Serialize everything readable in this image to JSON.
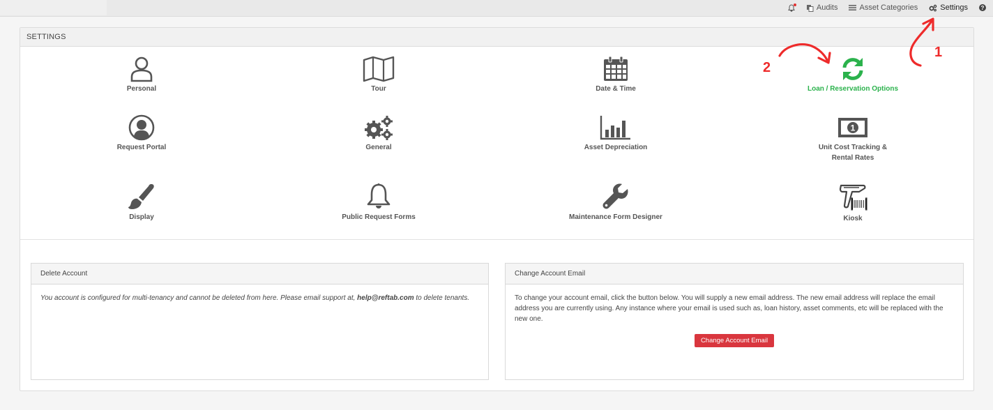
{
  "topnav": {
    "audits": "Audits",
    "asset_categories": "Asset Categories",
    "settings": "Settings"
  },
  "settings_panel": {
    "title": "SETTINGS",
    "tiles": [
      {
        "label": "Personal",
        "icon": "user-icon"
      },
      {
        "label": "Tour",
        "icon": "map-icon"
      },
      {
        "label": "Date & Time",
        "icon": "calendar-icon"
      },
      {
        "label": "Loan / Reservation Options",
        "icon": "refresh-icon"
      },
      {
        "label": "Request Portal",
        "icon": "user-circle-icon"
      },
      {
        "label": "General",
        "icon": "gears-icon"
      },
      {
        "label": "Asset Depreciation",
        "icon": "bar-chart-icon"
      },
      {
        "label": "Unit Cost Tracking &",
        "label2": "Rental Rates",
        "icon": "money-icon"
      },
      {
        "label": "Display",
        "icon": "paintbrush-icon"
      },
      {
        "label": "Public Request Forms",
        "icon": "bell-icon"
      },
      {
        "label": "Maintenance Form Designer",
        "icon": "wrench-icon"
      },
      {
        "label": "Kiosk",
        "icon": "barcode-scanner-icon"
      }
    ]
  },
  "delete_account": {
    "title": "Delete Account",
    "text_before": "You account is configured for multi-tenancy and cannot be deleted from here. Please email support at, ",
    "email": "help@reftab.com",
    "text_after": " to delete tenants."
  },
  "change_email": {
    "title": "Change Account Email",
    "text": "To change your account email, click the button below. You will supply a new email address. The new email address will replace the email address you are currently using. Any instance where your email is used such as, loan history, asset comments, etc will be replaced with the new one.",
    "button": "Change Account Email"
  },
  "annotations": {
    "one": "1",
    "two": "2"
  },
  "colors": {
    "accent_green": "#2bb24c",
    "danger_red": "#d9363e",
    "annotation_red": "#ee2b2b"
  }
}
